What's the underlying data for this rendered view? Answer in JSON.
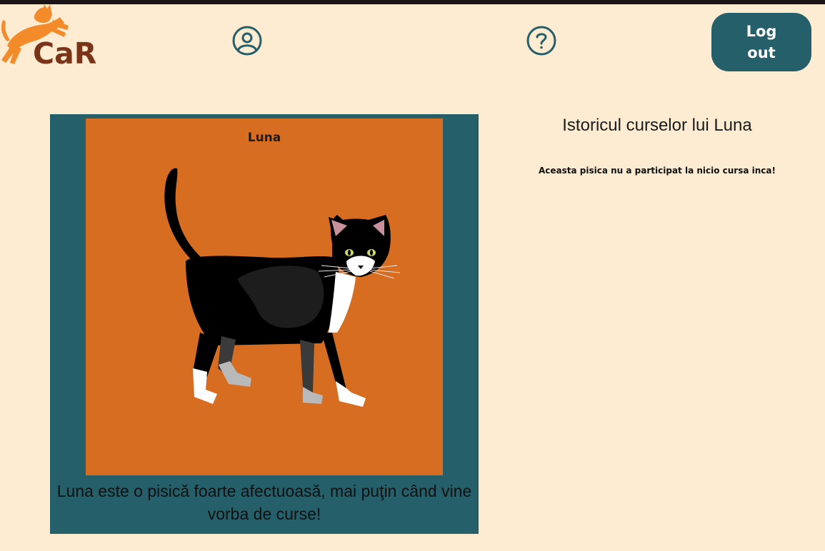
{
  "header": {
    "logo_text": "CaR",
    "profile_icon": "user-circle-icon",
    "help_icon": "question-circle-icon",
    "logout_label": "Log out",
    "colors": {
      "background": "#FDECD2",
      "accent": "#245F6A",
      "logo_cat": "#F38B2B",
      "logo_text": "#7A3417"
    }
  },
  "cat_card": {
    "name": "Luna",
    "image_icon": "tuxedo-cat-illustration",
    "description": "Luna este o pisică foarte afectuoasă, mai puţin când vine vorba de curse!",
    "colors": {
      "card_background": "#245F6A",
      "photo_background": "#D76D20"
    }
  },
  "history": {
    "title": "Istoricul curselor lui Luna",
    "empty_message": "Aceasta pisica nu a participat la nicio cursa inca!"
  }
}
